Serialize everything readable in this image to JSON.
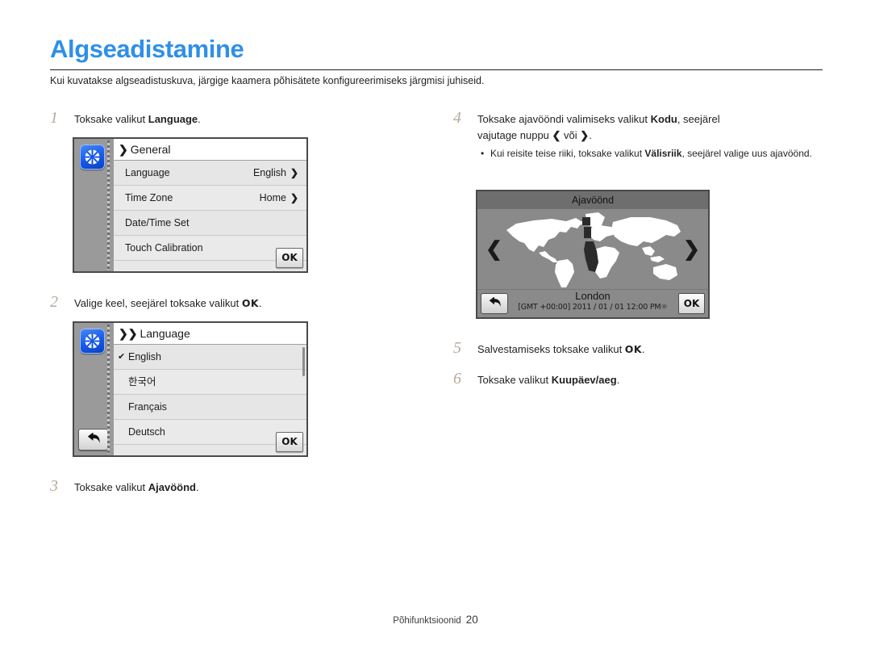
{
  "header": {
    "title": "Algseadistamine",
    "subtitle": "Kui kuvatakse algseadistuskuva, järgige kaamera põhisätete konfigureerimiseks järgmisi juhiseid.",
    "title_color": "#2f8fe8"
  },
  "steps": {
    "s1": {
      "num": "1",
      "text_before": "Toksake valikut ",
      "bold": "Language",
      "text_after": "."
    },
    "s2": {
      "num": "2",
      "text_before": "Valige keel, seejärel toksake valikut ",
      "ok": "OK",
      "text_after": "."
    },
    "s3": {
      "num": "3",
      "text_before": "Toksake valikut ",
      "bold": "Ajavöönd",
      "text_after": "."
    },
    "s4": {
      "num": "4",
      "line1_before": "Toksake ajavööndi valimiseks valikut ",
      "line1_bold": "Kodu",
      "line1_after": ", seejärel",
      "line2_before": "vajutage nuppu ",
      "left_arrow": "❮",
      "line2_mid": " või ",
      "right_arrow": "❯",
      "line2_after": ".",
      "bullet_dot": "•",
      "bullet_before": "Kui reisite teise riiki, toksake valikut ",
      "bullet_bold": "Välisriik",
      "bullet_after": ", seejärel valige uus ajavöönd."
    },
    "s5": {
      "num": "5",
      "text_before": "Salvestamiseks toksake valikut ",
      "ok": "OK",
      "text_after": "."
    },
    "s6": {
      "num": "6",
      "text_before": "Toksake valikut ",
      "bold": "Kuupäev/aeg",
      "text_after": "."
    }
  },
  "general_screen": {
    "icon": "gear-icon",
    "title_chevron": "❯",
    "title": "General",
    "rows": [
      {
        "label": "Language",
        "value": "English",
        "chevron": "❯"
      },
      {
        "label": "Time Zone",
        "value": "Home",
        "chevron": "❯"
      },
      {
        "label": "Date/Time Set",
        "value": "",
        "chevron": ""
      },
      {
        "label": "Touch Calibration",
        "value": "",
        "chevron": ""
      }
    ],
    "ok_label": "OK"
  },
  "language_screen": {
    "icon": "gear-icon",
    "title_chevron": "❯❯",
    "title": "Language",
    "back_label": "back-arrow",
    "items": [
      {
        "label": "English",
        "selected": true,
        "check": "✔"
      },
      {
        "label": "한국어",
        "selected": false,
        "check": ""
      },
      {
        "label": "Français",
        "selected": false,
        "check": ""
      },
      {
        "label": "Deutsch",
        "selected": false,
        "check": ""
      }
    ],
    "ok_label": "OK"
  },
  "timezone_screen": {
    "title": "Ajavöönd",
    "left_arrow": "❮",
    "right_arrow": "❯",
    "city": "London",
    "info": "[GMT +00:00] 2011 / 01 / 01  12:00 PM",
    "dst_icon": "sun-icon",
    "back_label": "back-arrow",
    "ok_label": "OK"
  },
  "footer": {
    "section": "Põhifunktsioonid",
    "page": "20"
  }
}
